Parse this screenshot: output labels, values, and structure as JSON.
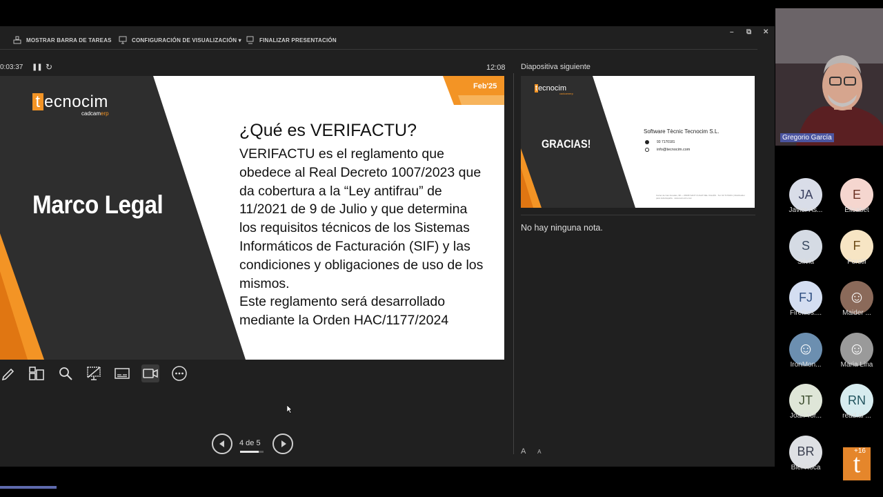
{
  "toolbar": {
    "taskbar_label": "MOSTRAR BARRA DE TAREAS",
    "display_settings_label": "CONFIGURACIÓN DE VISUALIZACIÓN ▾",
    "end_show_label": "FINALIZAR PRESENTACIÓN",
    "minimize": "–",
    "restore": "⧉",
    "close": "✕"
  },
  "status": {
    "elapsed": "0:03:37",
    "clock": "12:08"
  },
  "current_slide": {
    "logo_first": "t",
    "logo_rest": "ecnocim",
    "logo_sub_a": "cadcam",
    "logo_sub_b": "erp",
    "section": "Marco Legal",
    "date_tag": "Feb'25",
    "title": "¿Qué es VERIFACTU?",
    "body": [
      "VERIFACTU es el reglamento que",
      "obedece al Real Decreto 1007/2023 que",
      "da cobertura a la “Ley antifrau” de",
      "11/2021 de 9 de Julio  y que determina",
      "los requisitos técnicos de los Sistemas",
      "Informáticos de Facturación (SIF) y las",
      "condiciones y obligaciones de uso de los",
      "mismos.",
      "Este reglamento será desarrollado",
      "mediante la Orden HAC/1177/2024"
    ]
  },
  "navigation": {
    "page_label": "4 de 5",
    "progress": 0.8
  },
  "next_slide": {
    "heading": "Diapositiva siguiente",
    "logo_first": "t",
    "logo_rest": "ecnocim",
    "logo_sub": "cadcamerp",
    "thanks": "GRACIAS!",
    "company": "Software Tècnic Tecnocim S.L.",
    "phone": "93 7170181",
    "email": "info@tecnocim.com",
    "address": "Carrer de Can Amades, 98 — 08195 SANT CUGAT DEL VALLÈS · Tel. 93 7170181 | Distribuïdor para toda España · www.tecnocim.com"
  },
  "notes": {
    "text": "No hay ninguna nota.",
    "font_up": "A",
    "font_down": "A"
  },
  "speaker": {
    "name": "Gregorio García"
  },
  "participants": [
    {
      "initials": "JA",
      "name": "Javier As...",
      "bg": "#d9dde8",
      "fg": "#3a4060"
    },
    {
      "initials": "E",
      "name": "Elisabet",
      "bg": "#f5d6cf",
      "fg": "#6a2f22"
    },
    {
      "initials": "S",
      "name": "Silvia",
      "bg": "#d5dbe4",
      "fg": "#3a4a60"
    },
    {
      "initials": "F",
      "name": "Forstil",
      "bg": "#f7e5c4",
      "fg": "#6b4a16"
    },
    {
      "initials": "FJ",
      "name": "Fireflies....",
      "bg": "#d4def1",
      "fg": "#2e4e80"
    },
    {
      "initials": "",
      "name": "Maider ...",
      "bg": "#8b6a5a",
      "fg": "#fff"
    },
    {
      "initials": "",
      "name": "IronMon...",
      "bg": "#6c8fb0",
      "fg": "#fff"
    },
    {
      "initials": "",
      "name": "Maria Lina",
      "bg": "#9a9a9a",
      "fg": "#fff"
    },
    {
      "initials": "JT",
      "name": "Joan Tor...",
      "bg": "#dfe6d8",
      "fg": "#3f5032"
    },
    {
      "initials": "RN",
      "name": "read.ai ...",
      "bg": "#d7ecef",
      "fg": "#21545e"
    },
    {
      "initials": "BR",
      "name": "Biel Roca",
      "bg": "#dee0e4",
      "fg": "#3b4050"
    }
  ],
  "participants_more": "+16",
  "brand_logo": "t",
  "colors": {
    "accent_orange": "#f39425",
    "slide_dark": "#2e2e2e",
    "speaker_tag": "#4b55a0"
  }
}
